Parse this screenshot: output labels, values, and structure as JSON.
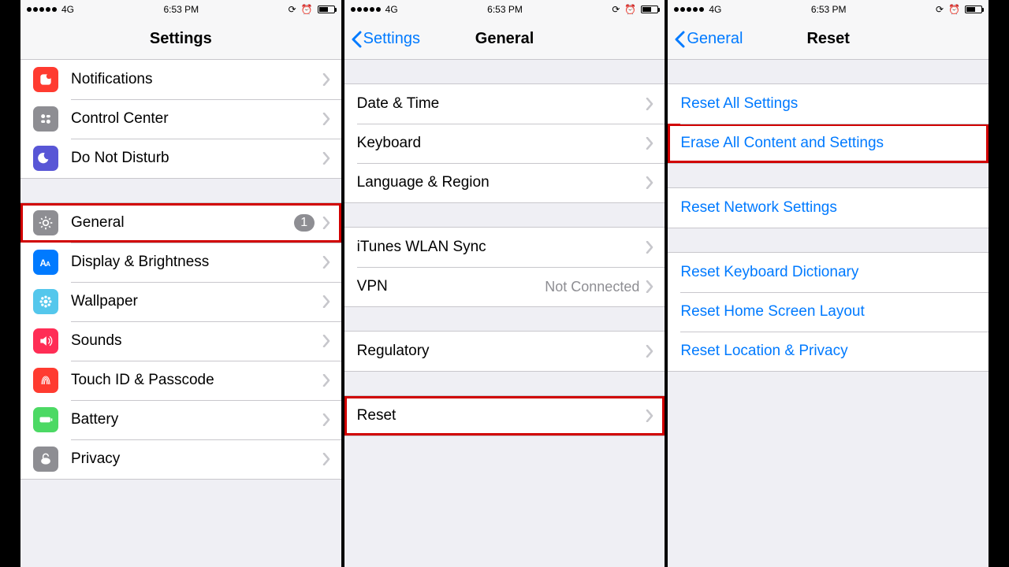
{
  "status": {
    "carrier": "4G",
    "time": "6:53 PM"
  },
  "screen1": {
    "title": "Settings",
    "group1": [
      {
        "label": "Notifications"
      },
      {
        "label": "Control Center"
      },
      {
        "label": "Do Not Disturb"
      }
    ],
    "group2": [
      {
        "label": "General",
        "badge": "1",
        "highlight": true
      },
      {
        "label": "Display & Brightness"
      },
      {
        "label": "Wallpaper"
      },
      {
        "label": "Sounds"
      },
      {
        "label": "Touch ID & Passcode"
      },
      {
        "label": "Battery"
      },
      {
        "label": "Privacy"
      }
    ]
  },
  "screen2": {
    "back": "Settings",
    "title": "General",
    "group1": [
      {
        "label": "Date & Time"
      },
      {
        "label": "Keyboard"
      },
      {
        "label": "Language & Region"
      }
    ],
    "group2": [
      {
        "label": "iTunes WLAN Sync"
      },
      {
        "label": "VPN",
        "value": "Not Connected"
      }
    ],
    "group3": [
      {
        "label": "Regulatory"
      }
    ],
    "group4": [
      {
        "label": "Reset",
        "highlight": true
      }
    ]
  },
  "screen3": {
    "back": "General",
    "title": "Reset",
    "group1": [
      {
        "label": "Reset All Settings"
      },
      {
        "label": "Erase All Content and Settings",
        "highlight": true
      }
    ],
    "group2": [
      {
        "label": "Reset Network Settings"
      }
    ],
    "group3": [
      {
        "label": "Reset Keyboard Dictionary"
      },
      {
        "label": "Reset Home Screen Layout"
      },
      {
        "label": "Reset Location & Privacy"
      }
    ]
  },
  "icons": {
    "notifications": "#ff3b30",
    "controlcenter": "#8e8e93",
    "dnd": "#5856d6",
    "general": "#8e8e93",
    "display": "#007aff",
    "wallpaper": "#54c7ec",
    "sounds": "#ff2d55",
    "touchid": "#ff3b30",
    "battery": "#4cd964",
    "privacy": "#8e8e93"
  }
}
